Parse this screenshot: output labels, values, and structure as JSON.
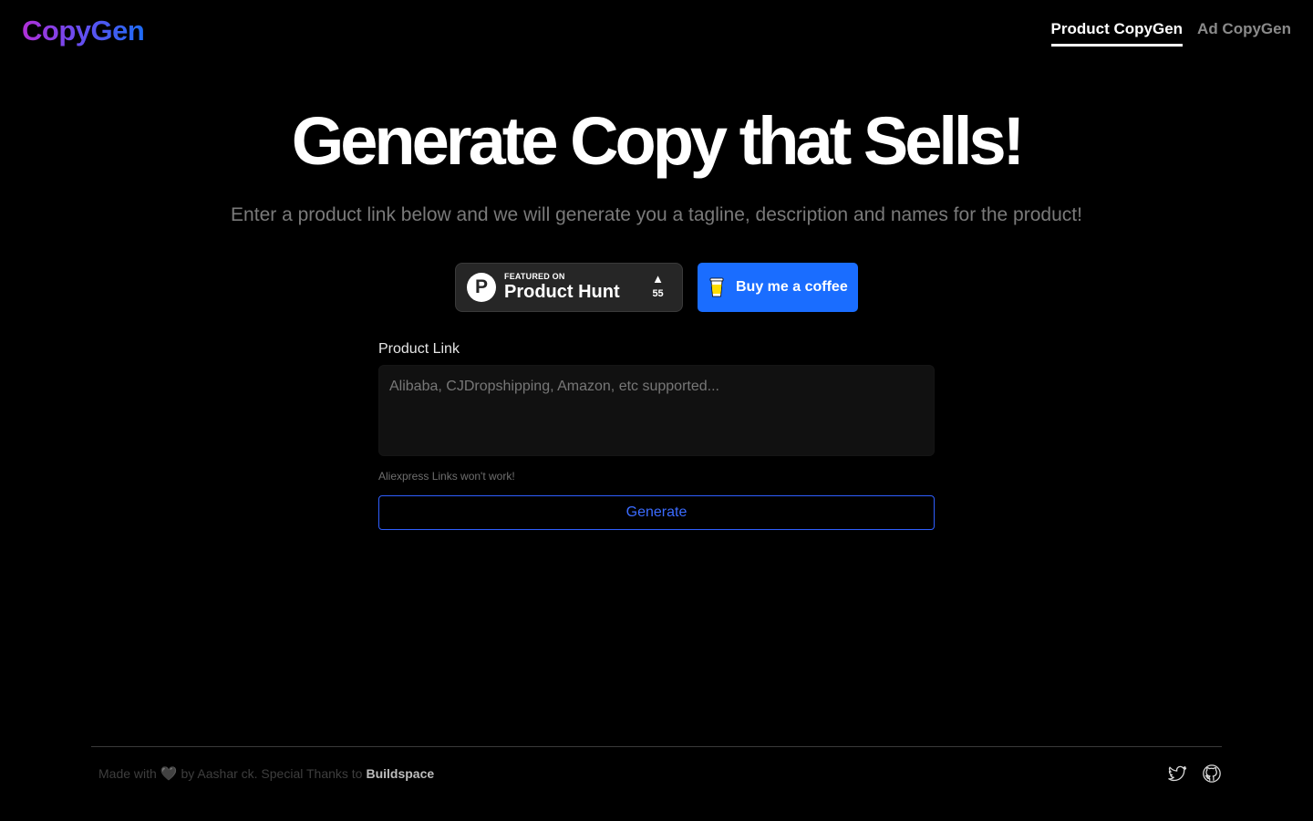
{
  "header": {
    "logo": "CopyGen",
    "tabs": [
      {
        "label": "Product CopyGen",
        "active": true
      },
      {
        "label": "Ad CopyGen",
        "active": false
      }
    ]
  },
  "hero": {
    "title": "Generate Copy that Sells!",
    "subtitle": "Enter a product link below and we will generate you a tagline, description and names for the product!"
  },
  "badges": {
    "product_hunt": {
      "logo_letter": "P",
      "small_text": "FEATURED ON",
      "big_text": "Product Hunt",
      "arrow": "▲",
      "votes": "55"
    },
    "coffee": {
      "label": "Buy me a coffee",
      "color": "#1a6dff"
    }
  },
  "form": {
    "label": "Product Link",
    "placeholder": "Alibaba, CJDropshipping, Amazon, etc supported...",
    "value": "",
    "hint": "Aliexpress Links won't work!",
    "button_label": "Generate",
    "accent": "#2f5fff"
  },
  "footer": {
    "made_with": "Made with",
    "heart": "🖤",
    "by_text": "by Aashar ck. Special Thanks to",
    "link": "Buildspace",
    "icons": [
      "twitter-icon",
      "github-icon"
    ]
  }
}
